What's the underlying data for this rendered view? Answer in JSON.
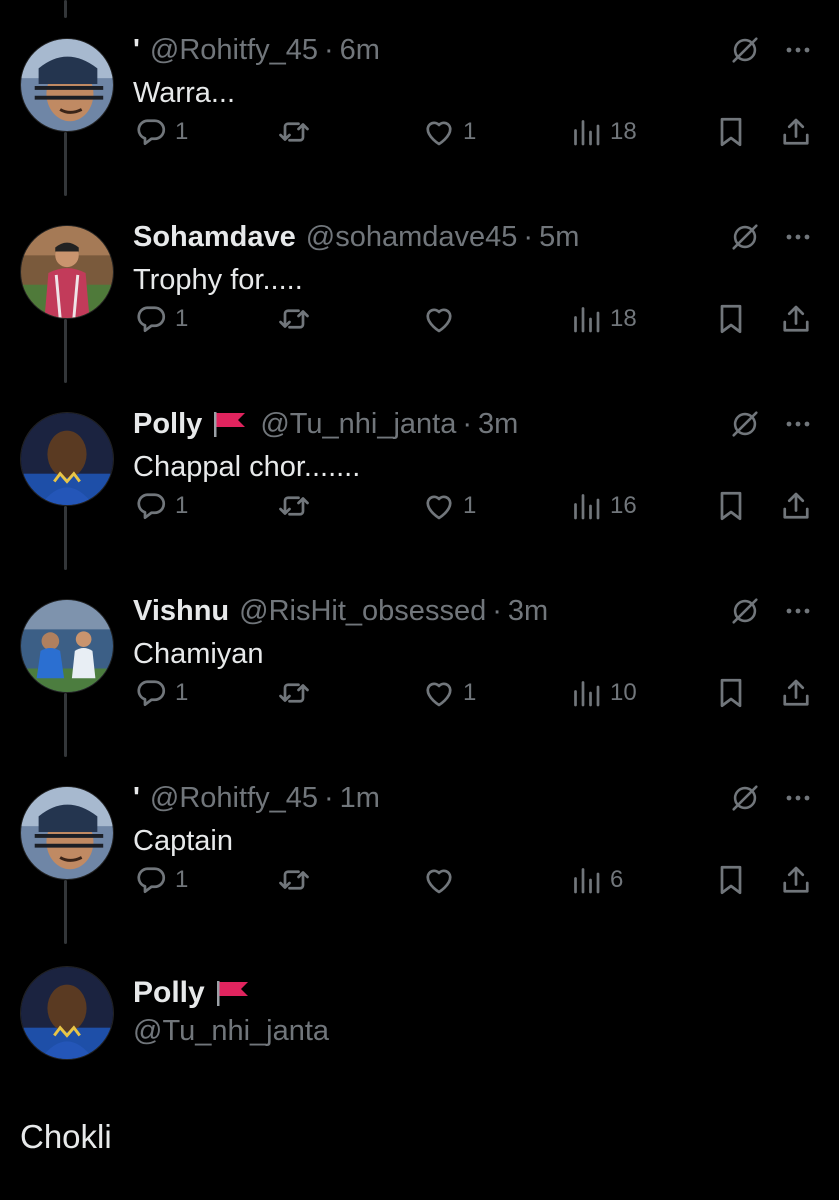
{
  "theme": {
    "background": "#000000",
    "text_primary": "#e7e9ea",
    "text_secondary": "#71767b",
    "thread_line": "#333639",
    "flag_red": "#e0245e"
  },
  "replies": [
    {
      "name": "'",
      "handle": "@Rohitfy_45",
      "time": "6m",
      "text": "Warra...",
      "avatar_icon": "helmet-player-avatar",
      "counts": {
        "reply": "1",
        "retweet": "",
        "like": "1",
        "views": "18"
      }
    },
    {
      "name": "Sohamdave",
      "handle": "@sohamdave45",
      "time": "5m",
      "text": "Trophy for.....",
      "avatar_icon": "player-photo-avatar",
      "counts": {
        "reply": "1",
        "retweet": "",
        "like": "",
        "views": "18"
      }
    },
    {
      "name": "Polly",
      "handle": "@Tu_nhi_janta",
      "time": "3m",
      "text": "Chappal chor.......",
      "avatar_icon": "player-portrait-avatar",
      "counts": {
        "reply": "1",
        "retweet": "",
        "like": "1",
        "views": "16"
      }
    },
    {
      "name": "Vishnu",
      "handle": "@RisHit_obsessed",
      "time": "3m",
      "text": "Chamiyan",
      "avatar_icon": "stadium-avatar",
      "counts": {
        "reply": "1",
        "retweet": "",
        "like": "1",
        "views": "10"
      }
    },
    {
      "name": "'",
      "handle": "@Rohitfy_45",
      "time": "1m",
      "text": "Captain",
      "avatar_icon": "helmet-player-avatar",
      "counts": {
        "reply": "1",
        "retweet": "",
        "like": "",
        "views": "6"
      }
    }
  ],
  "main_tweet": {
    "name": "Polly",
    "handle": "@Tu_nhi_janta",
    "text": "Chokli",
    "avatar_icon": "player-portrait-avatar"
  },
  "icons": {
    "reply": "reply-icon",
    "retweet": "retweet-icon",
    "like": "heart-icon",
    "views": "views-icon",
    "bookmark": "bookmark-icon",
    "share": "share-icon",
    "grok": "grok-icon",
    "more": "more-icon",
    "flag": "red-flag-icon"
  }
}
